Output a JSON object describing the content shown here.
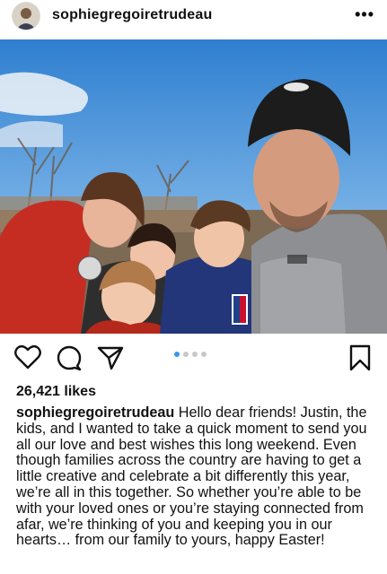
{
  "post": {
    "username": "sophiegregoiretrudeau",
    "more_label": "•••",
    "likes": "26,421 likes",
    "caption_user": "sophiegregoiretrudeau",
    "caption_text": " Hello dear friends! Justin, the kids, and I wanted to take a quick moment to send you all our love and best wishes this long weekend. Even though families across the country are having to get a little creative and celebrate a bit differently this year, we’re all in this together. So whether you’re able to be with your loved ones or you’re staying connected from afar, we’re thinking of you and keeping you in our hearts… from our family to yours, happy Easter!",
    "carousel": {
      "total": 4,
      "active_index": 0
    }
  },
  "icons": {
    "like": "heart-icon",
    "comment": "comment-icon",
    "share": "share-icon",
    "save": "bookmark-icon",
    "more": "more-options-icon"
  },
  "colors": {
    "accent_dot": "#3897f0",
    "inactive_dot": "#c7c7c7"
  }
}
